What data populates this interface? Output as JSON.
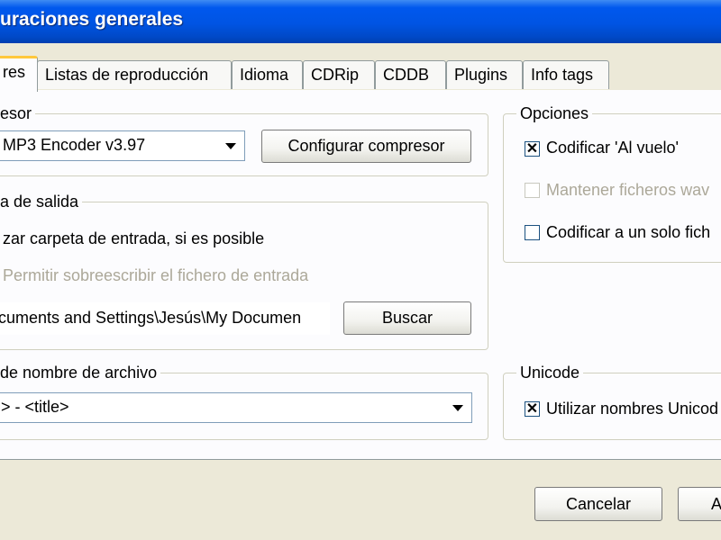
{
  "window": {
    "title": "uraciones generales"
  },
  "tabs": [
    {
      "label": "res"
    },
    {
      "label": "Listas de reproducción"
    },
    {
      "label": "Idioma"
    },
    {
      "label": "CDRip"
    },
    {
      "label": "CDDB"
    },
    {
      "label": "Plugins"
    },
    {
      "label": "Info tags"
    }
  ],
  "compressor": {
    "legend": "esor",
    "selected": "MP3 Encoder v3.97",
    "configure_label": "Configurar compresor"
  },
  "output_folder": {
    "legend": "a de salida",
    "use_input_label": "zar carpeta de entrada, si es posible",
    "overwrite_label": "Permitir sobreescribir el fichero de entrada",
    "path_value": "cuments and Settings\\Jesús\\My Documen",
    "browse_label": "Buscar"
  },
  "filename_format": {
    "legend": "de nombre de archivo",
    "selected": "> - <title>"
  },
  "options": {
    "legend": "Opciones",
    "on_the_fly_label": "Codificar 'Al vuelo'",
    "on_the_fly_checked": true,
    "keep_wav_label": "Mantener ficheros wav",
    "keep_wav_checked": false,
    "single_file_label": "Codificar a un solo fich",
    "single_file_checked": false
  },
  "unicode": {
    "legend": "Unicode",
    "use_unicode_label": "Utilizar nombres Unicod",
    "use_unicode_checked": true
  },
  "footer": {
    "cancel_label": "Cancelar",
    "accept_label": "A"
  }
}
